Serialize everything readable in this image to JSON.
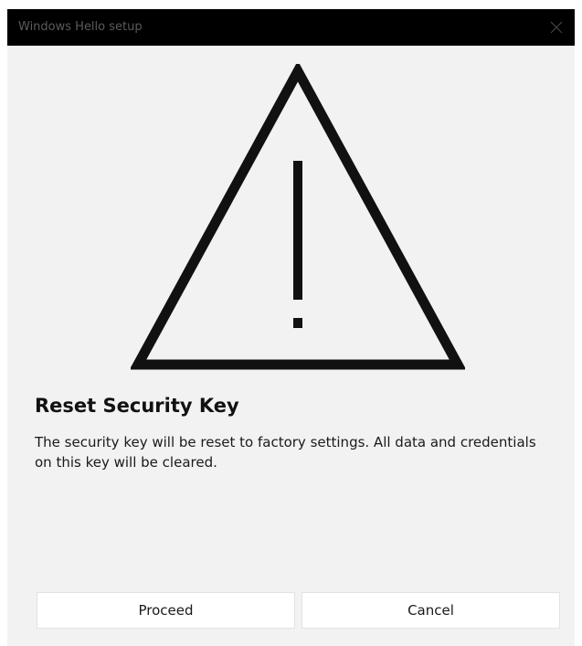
{
  "window": {
    "title": "Windows Hello setup",
    "close_icon": "close-icon"
  },
  "graphic": {
    "icon": "warning-triangle-icon",
    "color": "#111111"
  },
  "content": {
    "heading": "Reset Security Key",
    "description": "The security key will be reset to factory settings. All data and credentials on this key will be cleared."
  },
  "buttons": {
    "proceed_label": "Proceed",
    "cancel_label": "Cancel"
  },
  "colors": {
    "titlebar_bg": "#000000",
    "dialog_bg": "#f2f2f2",
    "button_bg": "#ffffff"
  }
}
